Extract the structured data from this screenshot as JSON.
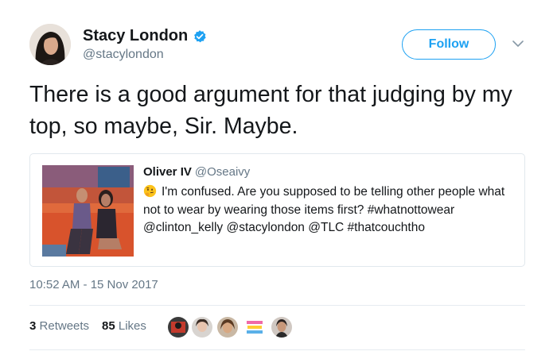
{
  "author": {
    "name": "Stacy London",
    "handle": "@stacylondon",
    "verified_icon": "verified-badge-icon",
    "follow_label": "Follow"
  },
  "tweet": {
    "text": "There is a good argument for that judging by my top, so maybe, Sir. Maybe."
  },
  "quoted": {
    "name": "Oliver IV",
    "handle": "@Oseaivy",
    "emoji": "thinking-face-icon",
    "text": "I'm confused. Are you supposed to be telling other people what not to wear by wearing those items first? #whatnottowear @clinton_kelly @stacylondon @TLC #thatcouchtho"
  },
  "meta": {
    "timestamp": "10:52 AM - 15 Nov 2017",
    "retweets_count": "3",
    "retweets_label": "Retweets",
    "likes_count": "85",
    "likes_label": "Likes"
  },
  "colors": {
    "accent": "#1da1f2",
    "secondary_text": "#657786",
    "border": "#e1e8ed"
  }
}
